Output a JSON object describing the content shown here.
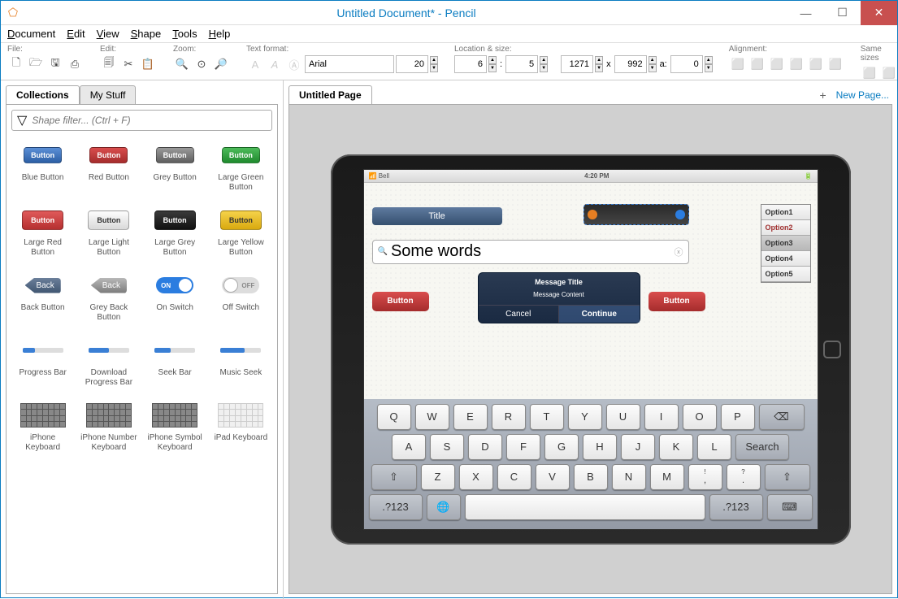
{
  "window": {
    "title": "Untitled Document* - Pencil"
  },
  "menu": [
    "Document",
    "Edit",
    "View",
    "Shape",
    "Tools",
    "Help"
  ],
  "toolbar": {
    "file_label": "File:",
    "edit_label": "Edit:",
    "zoom_label": "Zoom:",
    "text_label": "Text format:",
    "loc_label": "Location & size:",
    "align_label": "Alignment:",
    "same_label": "Same sizes",
    "font": "Arial",
    "font_size": "20",
    "loc_x": "6",
    "loc_y": "5",
    "size_w": "1271",
    "size_h": "992",
    "angle": "0",
    "x_sep": "x",
    "colon": ":",
    "a": "a:"
  },
  "left": {
    "tab1": "Collections",
    "tab2": "My Stuff",
    "filter_placeholder": "Shape filter... (Ctrl + F)",
    "shapes": [
      {
        "label": "Blue Button",
        "btn": "Button",
        "cls": "blue"
      },
      {
        "label": "Red Button",
        "btn": "Button",
        "cls": "red"
      },
      {
        "label": "Grey Button",
        "btn": "Button",
        "cls": "grey"
      },
      {
        "label": "Large Green Button",
        "btn": "Button",
        "cls": "green"
      },
      {
        "label": "Large Red Button",
        "btn": "Button",
        "cls": "lred"
      },
      {
        "label": "Large Light Button",
        "btn": "Button",
        "cls": "llight"
      },
      {
        "label": "Large Grey Button",
        "btn": "Button",
        "cls": "lgrey"
      },
      {
        "label": "Large Yellow Button",
        "btn": "Button",
        "cls": "lyellow"
      },
      {
        "label": "Back Button",
        "btn": "Back",
        "cls": "back"
      },
      {
        "label": "Grey Back Button",
        "btn": "Back",
        "cls": "backgrey"
      },
      {
        "label": "On Switch",
        "btn": "ON",
        "cls": "swon"
      },
      {
        "label": "Off Switch",
        "btn": "OFF",
        "cls": "swoff"
      },
      {
        "label": "Progress Bar",
        "cls": "bar",
        "fill": 30
      },
      {
        "label": "Download Progress Bar",
        "cls": "bar",
        "fill": 50
      },
      {
        "label": "Seek Bar",
        "cls": "bar",
        "fill": 40
      },
      {
        "label": "Music Seek",
        "cls": "bar",
        "fill": 60
      },
      {
        "label": "iPhone Keyboard",
        "cls": "kbd"
      },
      {
        "label": "iPhone Number Keyboard",
        "cls": "kbd"
      },
      {
        "label": "iPhone Symbol Keyboard",
        "cls": "kbd"
      },
      {
        "label": "iPad Keyboard",
        "cls": "kbdl"
      }
    ]
  },
  "canvas": {
    "page_tab": "Untitled Page",
    "new_page": "New Page...",
    "ipad": {
      "carrier": "Bell",
      "time": "4:20 PM",
      "title_bar": "Title",
      "text_field": "Some words",
      "options": [
        "Option1",
        "Option2",
        "Option3",
        "Option4",
        "Option5"
      ],
      "button_label": "Button",
      "msg": {
        "title": "Message Title",
        "content": "Message Content",
        "cancel": "Cancel",
        "continue": "Continue"
      },
      "kbd": {
        "r1": [
          "Q",
          "W",
          "E",
          "R",
          "T",
          "Y",
          "U",
          "I",
          "O",
          "P",
          "⌫"
        ],
        "r2": [
          "A",
          "S",
          "D",
          "F",
          "G",
          "H",
          "J",
          "K",
          "L",
          "Search"
        ],
        "r3": [
          "⇧",
          "Z",
          "X",
          "C",
          "V",
          "B",
          "N",
          "M",
          "!",
          ",",
          "?",
          ".",
          "⇧"
        ],
        "r4": [
          ".?123",
          "🌐",
          "",
          ".?123",
          "⌨"
        ]
      }
    }
  }
}
